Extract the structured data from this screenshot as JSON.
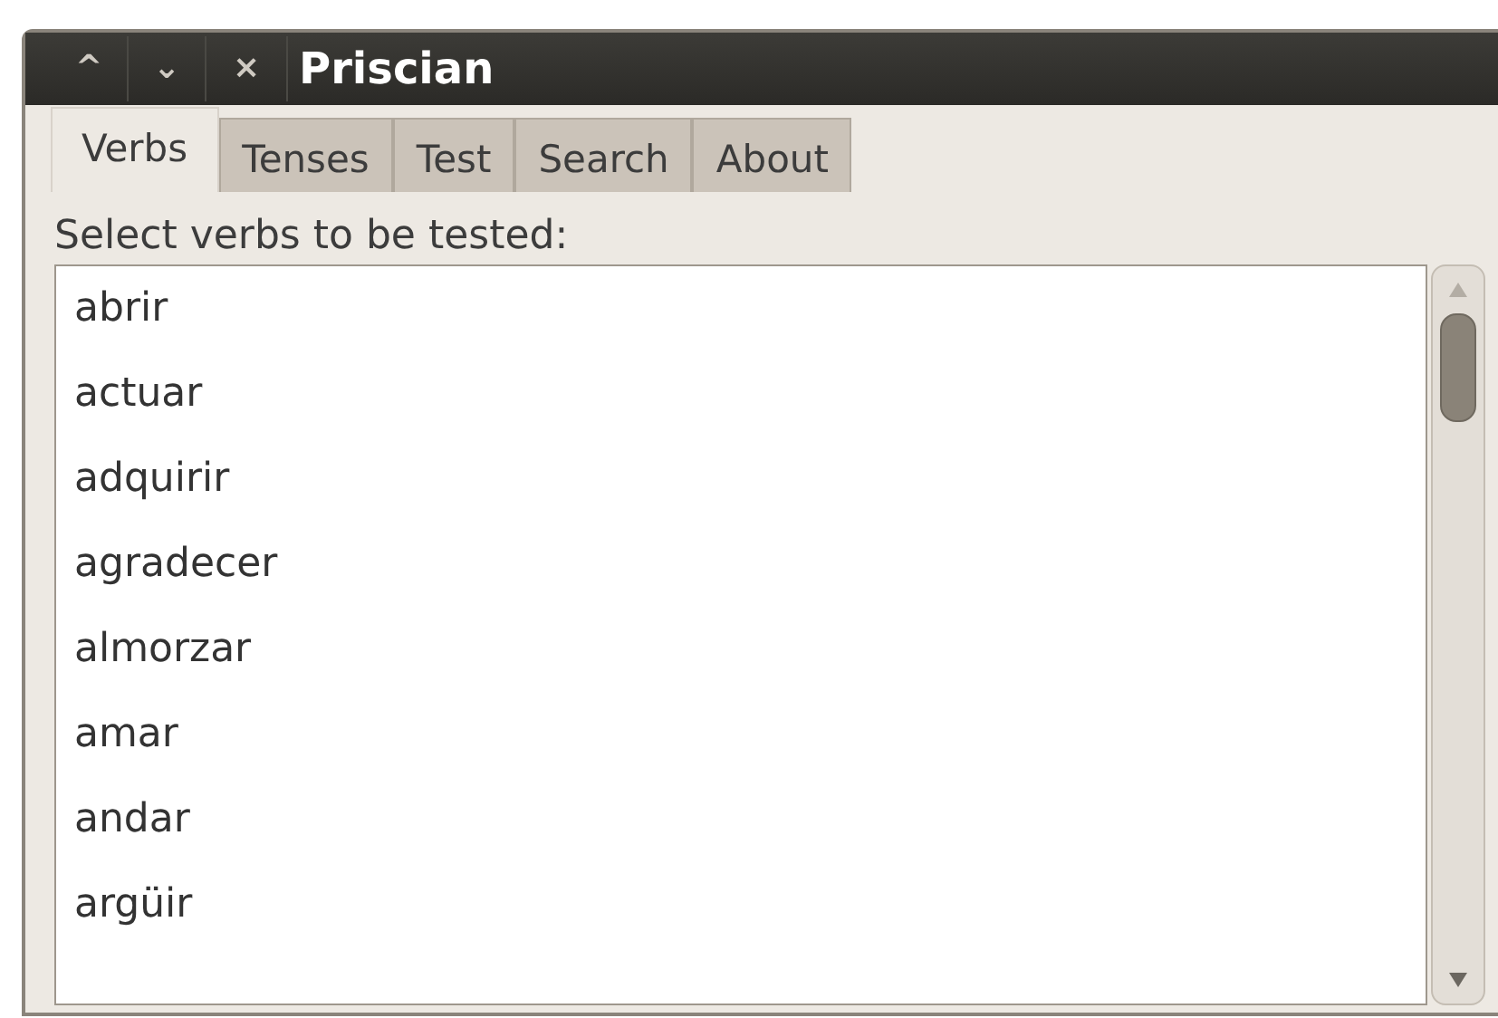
{
  "window": {
    "title": "Priscian",
    "buttons": [
      "^",
      "⌄",
      "×"
    ]
  },
  "tabs": [
    {
      "label": "Verbs",
      "selected": true
    },
    {
      "label": "Tenses",
      "selected": false
    },
    {
      "label": "Test",
      "selected": false
    },
    {
      "label": "Search",
      "selected": false
    },
    {
      "label": "About",
      "selected": false
    }
  ],
  "prompt": "Select verbs to be tested:",
  "verbs": [
    "abrir",
    "actuar",
    "adquirir",
    "agradecer",
    "almorzar",
    "amar",
    "andar",
    "argüir"
  ]
}
